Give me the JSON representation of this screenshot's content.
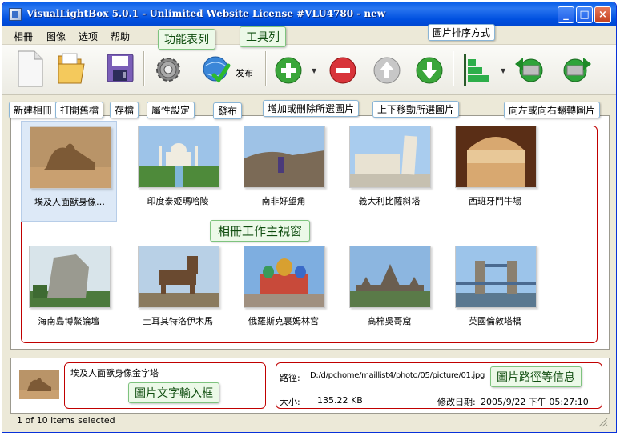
{
  "window": {
    "title": "VisualLightBox 5.0.1 - Unlimited Website License #VLU4780 - new",
    "min": "_",
    "max": "□",
    "close": "×"
  },
  "menu": [
    "相冊",
    "图像",
    "选项",
    "帮助"
  ],
  "toolbar": {
    "publish_label": "发布"
  },
  "annotations": {
    "menu_bar": "功能表列",
    "toolbar": "工具列",
    "sort": "圖片排序方式",
    "new_album": "新建相冊",
    "open_file": "打開舊檔",
    "save": "存檔",
    "properties": "屬性設定",
    "publish": "發布",
    "add_remove": "增加或刪除所選圖片",
    "move": "上下移動所選圖片",
    "rotate": "向左或向右翻轉圖片",
    "main_window": "相冊工作主視窗",
    "text_input": "圖片文字輸入框",
    "path_info": "圖片路徑等信息"
  },
  "thumbnails": [
    {
      "caption": "埃及人面獸身像…",
      "selected": true
    },
    {
      "caption": "印度泰姬瑪哈陵",
      "selected": false
    },
    {
      "caption": "南非好望角",
      "selected": false
    },
    {
      "caption": "義大利比薩斜塔",
      "selected": false
    },
    {
      "caption": "西班牙鬥牛場",
      "selected": false
    },
    {
      "caption": "海南島博鰲論壇",
      "selected": false
    },
    {
      "caption": "土耳其特洛伊木馬",
      "selected": false
    },
    {
      "caption": "俄羅斯克裏姆林宮",
      "selected": false
    },
    {
      "caption": "高棉吳哥窟",
      "selected": false
    },
    {
      "caption": "英國倫敦塔橋",
      "selected": false
    }
  ],
  "info": {
    "description": "埃及人面獸身像金字塔",
    "path_label": "路徑:",
    "path_value": "D:/d/pchome/maillist4/photo/05/picture/01.jpg",
    "size_label": "大小:",
    "size_value": "135.22 KB",
    "date_label": "修改日期:",
    "date_value": "2005/9/22 下午 05:27:10"
  },
  "status": {
    "text": "1 of 10 items selected"
  }
}
